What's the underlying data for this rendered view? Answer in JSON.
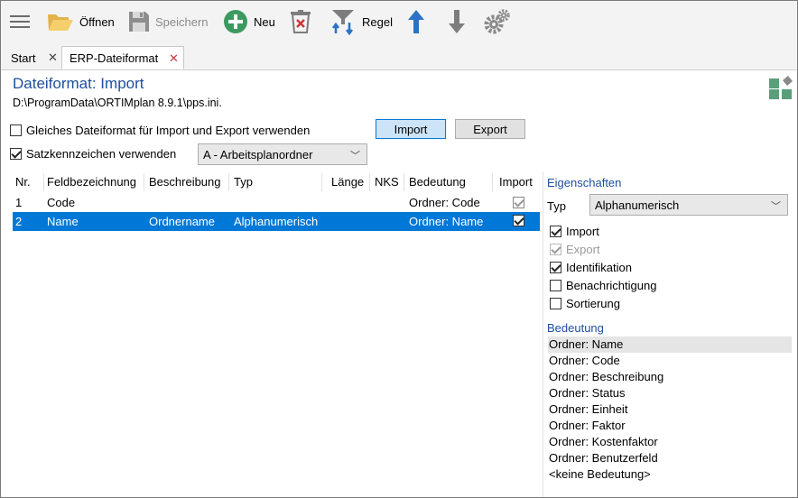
{
  "toolbar": {
    "open_label": "Öffnen",
    "save_label": "Speichern",
    "new_label": "Neu",
    "rule_label": "Regel"
  },
  "tabs": [
    {
      "label": "Start"
    },
    {
      "label": "ERP-Dateiformat"
    }
  ],
  "header": {
    "title": "Dateiformat: Import",
    "path": "D:\\ProgramData\\ORTIMplan 8.9.1\\pps.ini."
  },
  "options": {
    "same_format_label": "Gleiches Dateiformat für Import und Export verwenden",
    "same_format_checked": false,
    "record_id_label": "Satzkennzeichen verwenden",
    "record_id_checked": true,
    "import_button": "Import",
    "export_button": "Export",
    "record_type_value": "A - Arbeitsplanordner"
  },
  "grid": {
    "columns": [
      "Nr.",
      "Feldbezeichnung",
      "Beschreibung",
      "Typ",
      "Länge",
      "NKS",
      "Bedeutung",
      "Import"
    ],
    "rows": [
      {
        "nr": "1",
        "feld": "Code",
        "beschreibung": "",
        "typ": "",
        "laenge": "",
        "nks": "",
        "bedeutung": "Ordner: Code",
        "import": true,
        "selected": false
      },
      {
        "nr": "2",
        "feld": "Name",
        "beschreibung": "Ordnername",
        "typ": "Alphanumerisch",
        "laenge": "",
        "nks": "",
        "bedeutung": "Ordner: Name",
        "import": true,
        "selected": true
      }
    ]
  },
  "properties": {
    "title": "Eigenschaften",
    "type_label": "Typ",
    "type_value": "Alphanumerisch",
    "checks": [
      {
        "label": "Import",
        "checked": true,
        "disabled": false
      },
      {
        "label": "Export",
        "checked": true,
        "disabled": true
      },
      {
        "label": "Identifikation",
        "checked": true,
        "disabled": false
      },
      {
        "label": "Benachrichtigung",
        "checked": false,
        "disabled": false
      },
      {
        "label": "Sortierung",
        "checked": false,
        "disabled": false
      }
    ],
    "meaning_title": "Bedeutung",
    "meanings": [
      "Ordner: Name",
      "Ordner: Code",
      "Ordner: Beschreibung",
      "Ordner: Status",
      "Ordner: Einheit",
      "Ordner: Faktor",
      "Ordner: Kostenfaktor",
      "Ordner: Benutzerfeld",
      "<keine Bedeutung>"
    ],
    "selected_meaning_index": 0
  },
  "colors": {
    "accent": "#0078d7",
    "title_blue": "#1f4e9c",
    "toolbar_bg": "#f3f3f3",
    "icon_green": "#3c9a5f",
    "icon_blue": "#2b73c2",
    "close_red": "#d13438"
  },
  "icons": [
    "menu-icon",
    "folder-open-icon",
    "save-icon",
    "add-icon",
    "delete-icon",
    "rule-icon",
    "arrow-up-icon",
    "arrow-down-icon",
    "settings-icon",
    "shapes-icon",
    "close-icon",
    "chevron-down-icon"
  ]
}
